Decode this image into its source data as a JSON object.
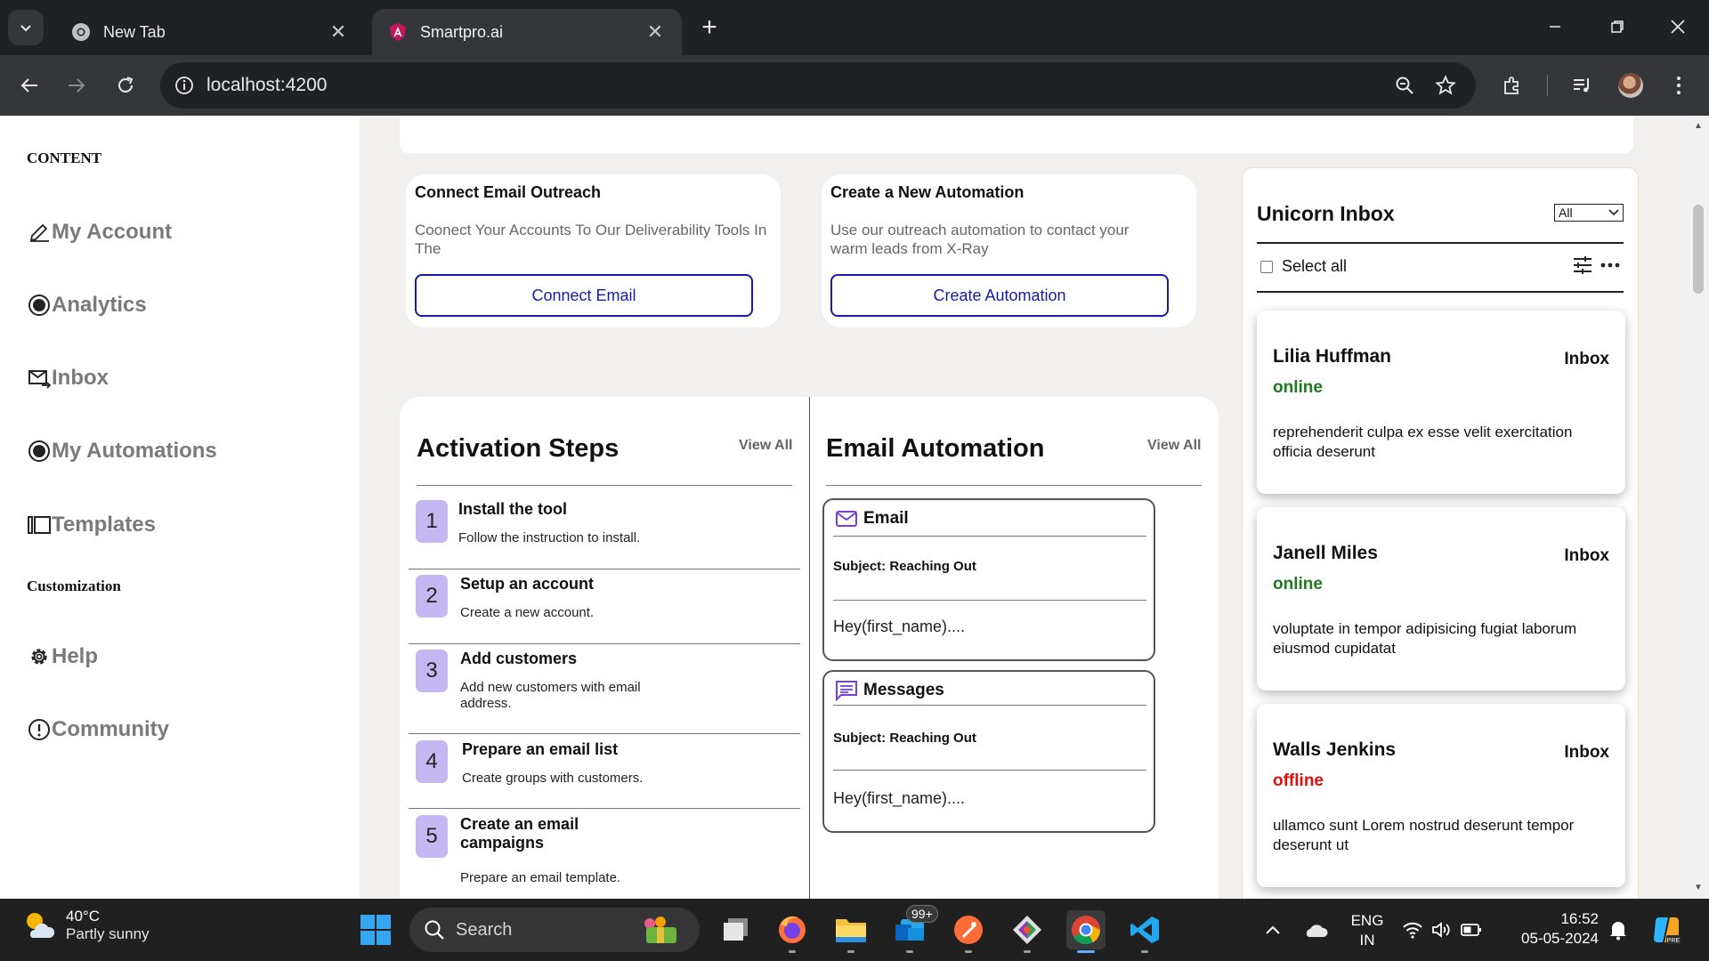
{
  "browser": {
    "tabs": [
      {
        "title": "New Tab",
        "icon": "chrome-icon",
        "active": false
      },
      {
        "title": "Smartpro.ai",
        "icon": "angular-icon",
        "active": true
      }
    ],
    "url": "localhost:4200"
  },
  "sidebar": {
    "heading_content": "CONTENT",
    "heading_customization": "Customization",
    "items": [
      {
        "label": "My Account",
        "icon": "pencil-icon"
      },
      {
        "label": "Analytics",
        "icon": "radio-target-icon"
      },
      {
        "label": "Inbox",
        "icon": "mail-forward-icon"
      },
      {
        "label": "My Automations",
        "icon": "radio-target-icon"
      },
      {
        "label": "Templates",
        "icon": "templates-icon"
      },
      {
        "label": "Help",
        "icon": "gear-icon"
      },
      {
        "label": "Community",
        "icon": "info-circle-icon"
      }
    ]
  },
  "cards": {
    "connect_email": {
      "title": "Connect Email Outreach",
      "description": "Coonect Your Accounts To Our Deliverability Tools In The",
      "button": "Connect Email"
    },
    "automation": {
      "title": "Create a New Automation",
      "description": "Use our outreach automation to contact your warm leads from X-Ray",
      "button": "Create Automation"
    }
  },
  "activation": {
    "title": "Activation Steps",
    "view_all": "View All",
    "steps": [
      {
        "num": "1",
        "title": "Install the tool",
        "desc": "Follow the instruction to install."
      },
      {
        "num": "2",
        "title": "Setup an account",
        "desc": "Create a new account."
      },
      {
        "num": "3",
        "title": "Add customers",
        "desc": "Add new customers with email address."
      },
      {
        "num": "4",
        "title": "Prepare an email list",
        "desc": "Create groups with customers."
      },
      {
        "num": "5",
        "title": "Create an email campaigns",
        "desc": "Prepare an email template."
      }
    ]
  },
  "email_automation": {
    "title": "Email Automation",
    "view_all": "View All",
    "items": [
      {
        "type": "Email",
        "icon": "mail-icon",
        "subject": "Subject: Reaching Out",
        "body": "Hey(first_name)...."
      },
      {
        "type": "Messages",
        "icon": "message-icon",
        "subject": "Subject: Reaching Out",
        "body": "Hey(first_name)...."
      }
    ]
  },
  "inbox": {
    "title": "Unicorn Inbox",
    "filter": "All",
    "select_all": "Select all",
    "messages": [
      {
        "name": "Lilia Huffman",
        "folder": "Inbox",
        "status": "online",
        "text": "reprehenderit culpa ex esse velit exercitation officia deserunt"
      },
      {
        "name": "Janell Miles",
        "folder": "Inbox",
        "status": "online",
        "text": "voluptate in tempor adipisicing fugiat laborum eiusmod cupidatat"
      },
      {
        "name": "Walls Jenkins",
        "folder": "Inbox",
        "status": "offline",
        "text": "ullamco sunt Lorem nostrud deserunt tempor deserunt ut"
      }
    ]
  },
  "taskbar": {
    "temperature": "40°C",
    "weather": "Partly sunny",
    "search": "Search",
    "badge": "99+",
    "lang_top": "ENG",
    "lang_bottom": "IN",
    "time": "16:52",
    "date": "05-05-2024"
  },
  "colors": {
    "accent_blue": "#1a1aa8",
    "step_badge": "#c5b8f2",
    "online": "#1f7a1f",
    "offline": "#e01010",
    "icon_purple": "#7b3fd6"
  }
}
